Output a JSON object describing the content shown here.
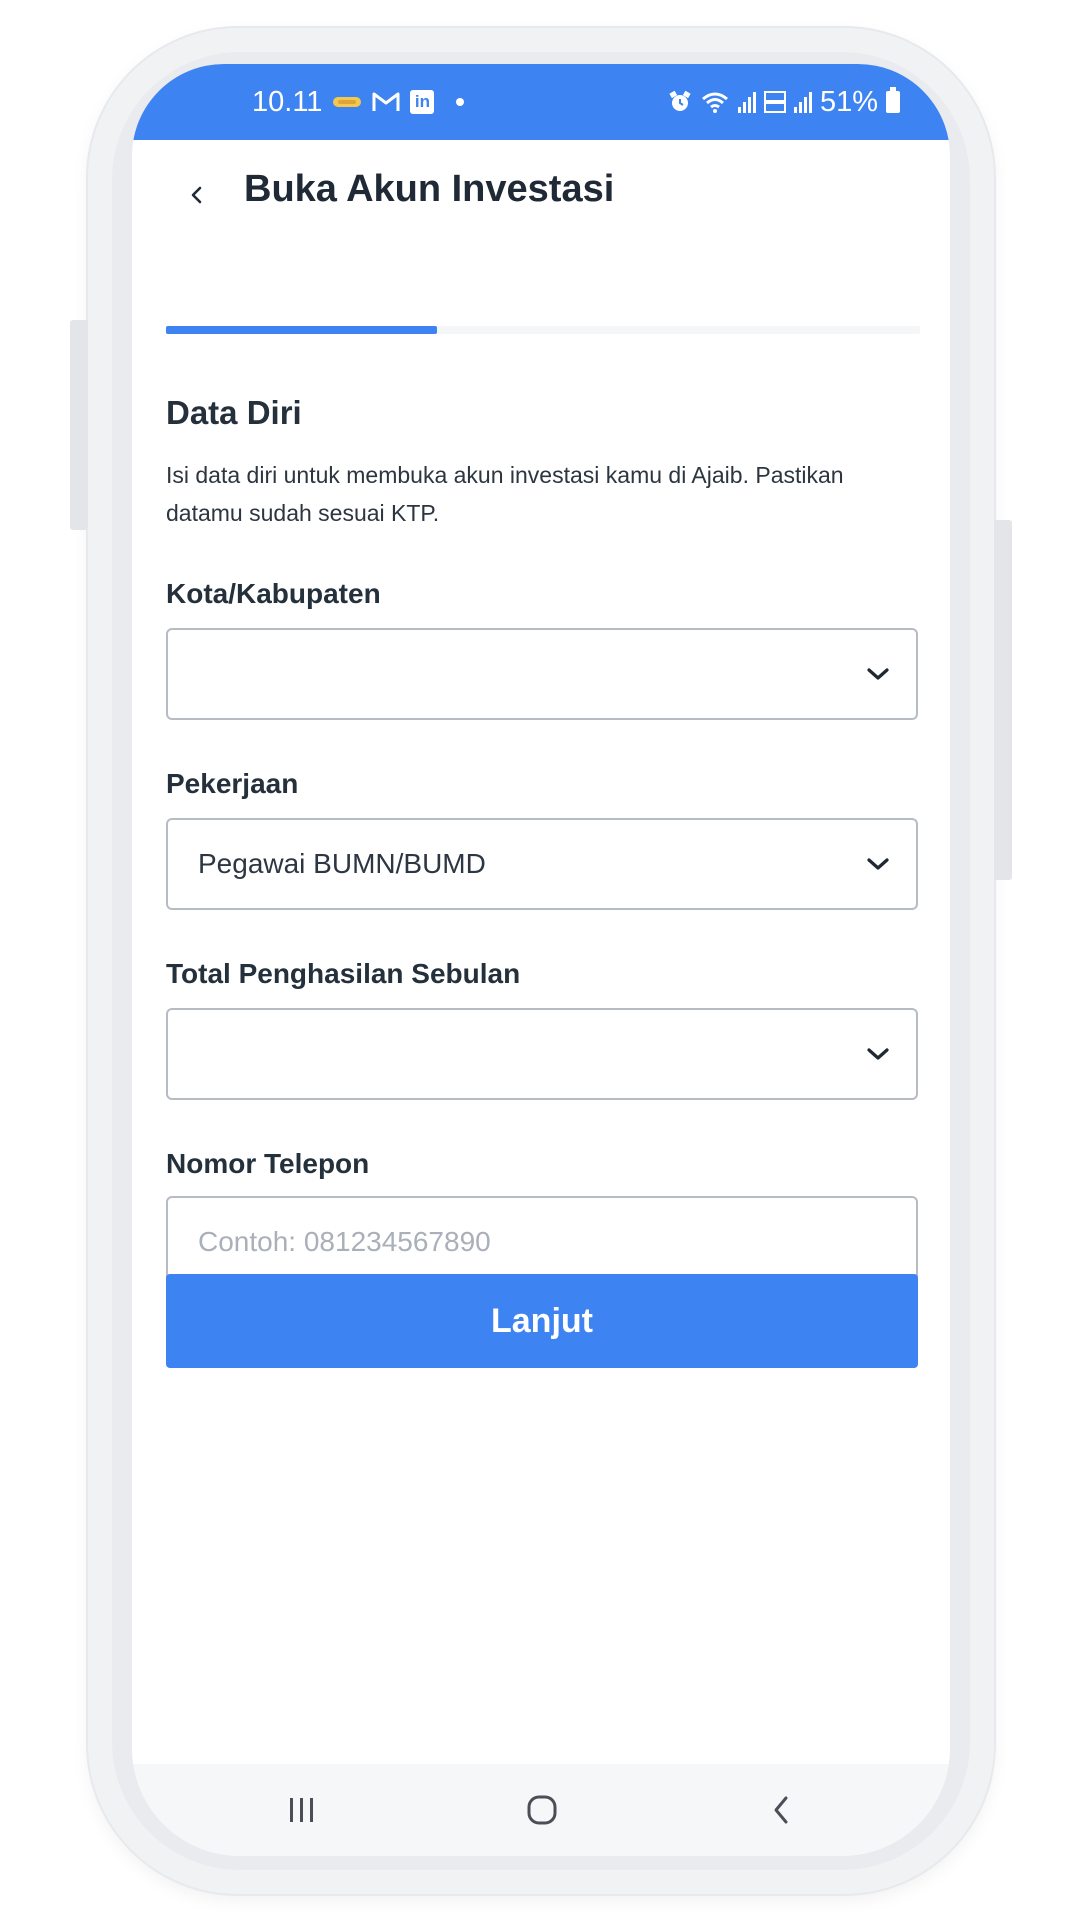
{
  "status_bar": {
    "time": "10.11",
    "battery": "51%",
    "left_icons": [
      "pinjam-notification-icon",
      "gmail-icon",
      "linkedin-icon",
      "dot-icon"
    ],
    "right_icons": [
      "alarm-icon",
      "wifi-icon",
      "signal-icon",
      "volte-icon",
      "signal-icon",
      "battery-icon"
    ],
    "linkedin_letters": "in",
    "color": "#3d83f2"
  },
  "header": {
    "title": "Buka Akun Investasi",
    "back_icon": "chevron-left-icon"
  },
  "progress": {
    "value": 0.36,
    "color": "#3d83f2"
  },
  "section": {
    "title": "Data Diri",
    "description": "Isi data diri untuk membuka akun investasi kamu di Ajaib. Pastikan datamu sudah sesuai KTP."
  },
  "fields": {
    "city": {
      "label": "Kota/Kabupaten",
      "value": "",
      "icon": "chevron-down-icon"
    },
    "job": {
      "label": "Pekerjaan",
      "value": "Pegawai BUMN/BUMD",
      "icon": "chevron-down-icon"
    },
    "income": {
      "label": "Total Penghasilan Sebulan",
      "value": "",
      "icon": "chevron-down-icon"
    },
    "phone": {
      "label": "Nomor Telepon",
      "value": "",
      "placeholder": "Contoh: 081234567890"
    }
  },
  "button": {
    "label": "Lanjut",
    "color": "#3d83f2"
  },
  "nav_bar": {
    "icons": [
      "recent-apps-icon",
      "home-icon",
      "back-icon"
    ]
  }
}
